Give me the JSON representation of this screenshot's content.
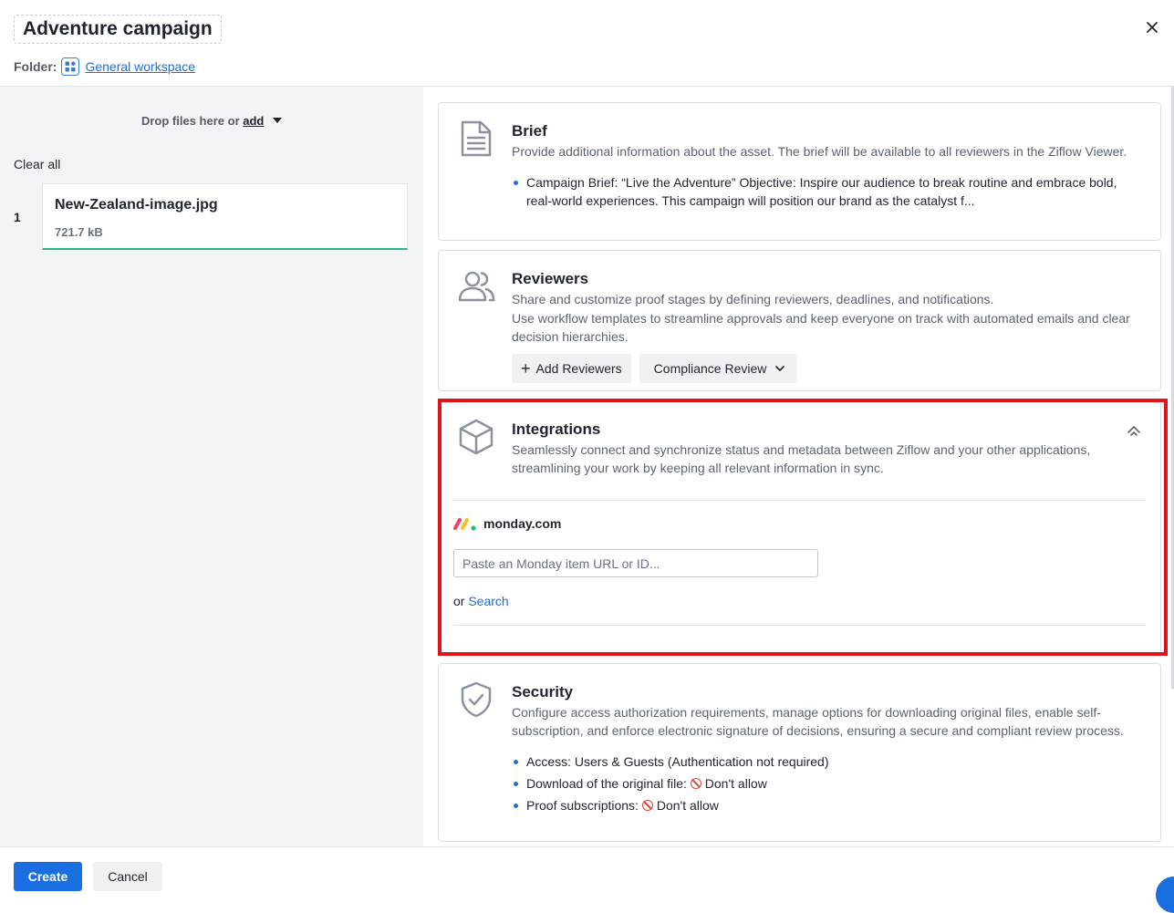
{
  "header": {
    "title": "Adventure campaign",
    "folder_label": "Folder:",
    "folder_name": "General workspace"
  },
  "left": {
    "drop_text": "Drop files here or",
    "drop_add": "add",
    "clear_all": "Clear all",
    "files": [
      {
        "index": "1",
        "name": "New-Zealand-image.jpg",
        "size": "721.7 kB"
      }
    ]
  },
  "brief": {
    "title": "Brief",
    "description": "Provide additional information about the asset. The brief will be available to all reviewers in the Ziflow Viewer.",
    "bullet": "Campaign Brief: “Live the Adventure”  Objective:  Inspire our audience to break routine and embrace bold, real-world experiences. This campaign will position our brand as the catalyst f..."
  },
  "reviewers": {
    "title": "Reviewers",
    "desc1": "Share and customize proof stages by defining reviewers, deadlines, and notifications.",
    "desc2": "Use workflow templates to streamline approvals and keep everyone on track with automated emails and clear decision hierarchies.",
    "add_button": "Add Reviewers",
    "template_button": "Compliance Review"
  },
  "integrations": {
    "title": "Integrations",
    "description": "Seamlessly connect and synchronize status and metadata between Ziflow and your other applications, streamlining your work by keeping all relevant information in sync.",
    "provider": "monday.com",
    "input_placeholder": "Paste an Monday item URL or ID...",
    "or_text": "or",
    "search_link": "Search"
  },
  "security": {
    "title": "Security",
    "description": "Configure access authorization requirements, manage options for downloading original files, enable self-subscription, and enforce electronic signature of decisions, ensuring a secure and compliant review process.",
    "access": "Access: Users & Guests (Authentication not required)",
    "download_label": "Download of the original file:",
    "download_value": "Don't allow",
    "subscriptions_label": "Proof subscriptions:",
    "subscriptions_value": "Don't allow"
  },
  "footer": {
    "create": "Create",
    "cancel": "Cancel"
  },
  "colors": {
    "primary": "#1a6fe0",
    "highlight": "#e0121a",
    "file_underline": "#2bb58a"
  }
}
